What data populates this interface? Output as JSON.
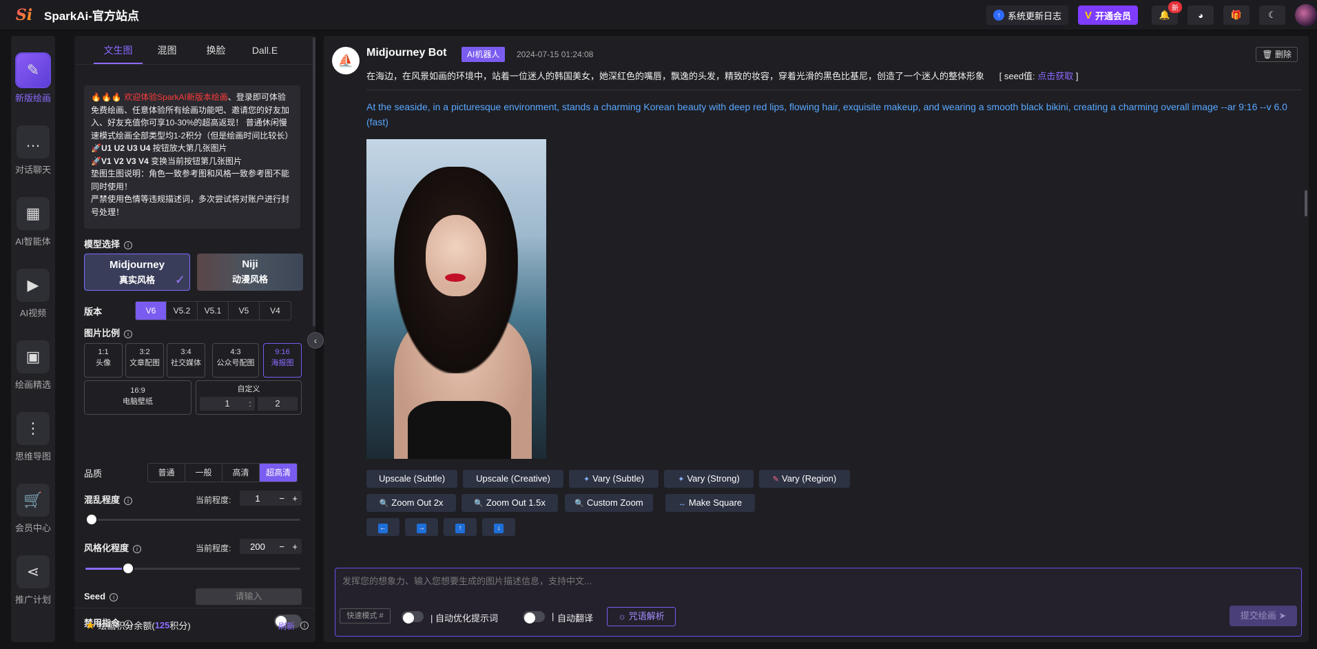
{
  "header": {
    "logo_mark": "Si",
    "title": "SparkAi-官方站点",
    "update_log": "系统更新日志",
    "vip_button": "开通会员",
    "new_badge": "新"
  },
  "nav": [
    {
      "label": "新版绘画",
      "icon": "paint-brush-icon",
      "glyph": "✎"
    },
    {
      "label": "对话聊天",
      "icon": "chat-bubble-icon",
      "glyph": "…"
    },
    {
      "label": "AI智能体",
      "icon": "grid-apps-icon",
      "glyph": "▦"
    },
    {
      "label": "AI视频",
      "icon": "video-icon",
      "glyph": "▶"
    },
    {
      "label": "绘画精选",
      "icon": "gallery-icon",
      "glyph": "▣"
    },
    {
      "label": "思维导图",
      "icon": "mindmap-icon",
      "glyph": "⋮"
    },
    {
      "label": "会员中心",
      "icon": "cart-icon",
      "glyph": "🛒"
    },
    {
      "label": "推广计划",
      "icon": "share-icon",
      "glyph": "⋖"
    }
  ],
  "panel": {
    "tabs": [
      "文生图",
      "混图",
      "换脸",
      "Dall.E"
    ],
    "notice": {
      "line1_red": "🔥🔥🔥 欢迎体验SparkAI新版本绘画",
      "line1_rest": "、登录即可体验免费绘画、任意体验所有绘画功能吧、邀请您的好友加入、好友充值你可享10-30%的超高返现！ 普通休闲慢速模式绘画全部类型均1-2积分（但是绘画时间比较长）",
      "u_line_bold": "🚀U1 U2 U3 U4",
      "u_line_rest": " 按钮放大第几张图片",
      "v_line_bold": "🚀V1 V2 V3 V4",
      "v_line_rest": " 变换当前按钮第几张图片",
      "line4": "垫图生图说明：角色一致参考图和风格一致参考图不能同时使用！",
      "line5": "严禁使用色情等违规描述词，多次尝试将对账户进行封号处理！"
    },
    "model_label": "模型选择",
    "models": [
      {
        "name": "Midjourney",
        "style": "真实风格"
      },
      {
        "name": "Niji",
        "style": "动漫风格"
      }
    ],
    "version_label": "版本",
    "versions": [
      "V6",
      "V5.2",
      "V5.1",
      "V5",
      "V4"
    ],
    "ratio_label": "图片比例",
    "ratios": [
      {
        "ratio": "1:1",
        "desc": "头像"
      },
      {
        "ratio": "3:2",
        "desc": "文章配图"
      },
      {
        "ratio": "3:4",
        "desc": "社交媒体"
      },
      {
        "ratio": "4:3",
        "desc": "公众号配图"
      },
      {
        "ratio": "9:16",
        "desc": "海报图"
      },
      {
        "ratio": "16:9",
        "desc": "电脑壁纸"
      }
    ],
    "custom_label": "自定义",
    "custom_w": "1",
    "custom_sep": ":",
    "custom_h": "2",
    "quality_label": "品质",
    "qualities": [
      "普通",
      "一般",
      "高清",
      "超高清"
    ],
    "chaos_label": "混乱程度",
    "current_label": "当前程度:",
    "chaos_value": "1",
    "chaos_level": 0.0,
    "stylize_label": "风格化程度",
    "stylize_value": "200",
    "stylize_level": 0.2,
    "seed_label": "Seed",
    "seed_placeholder": "请输入",
    "disable_label": "禁用指令",
    "credits_prefix": "绘画积分余额(",
    "credits_value": "125",
    "credits_suffix": "积分)",
    "refresh": "刷新"
  },
  "message": {
    "bot_name": "Midjourney Bot",
    "bot_tag": "AI机器人",
    "time": "2024-07-15 01:24:08",
    "delete": "删除",
    "prompt_cn": "在海边，在风景如画的环境中，站着一位迷人的韩国美女，她深红色的嘴唇，飘逸的头发，精致的妆容，穿着光滑的黑色比基尼，创造了一个迷人的整体形象",
    "seed_prefix": "[ seed值: ",
    "seed_link": "点击获取",
    "seed_suffix": " ]",
    "prompt_en": "At the seaside, in a picturesque environment, stands a charming Korean beauty with deep red lips, flowing hair, exquisite makeup, and wearing a smooth black bikini, creating a charming overall image --ar 9:16 --v 6.0  (fast)",
    "actions_row1": [
      "Upscale (Subtle)",
      "Upscale (Creative)",
      "Vary (Subtle)",
      "Vary (Strong)",
      "Vary (Region)"
    ],
    "actions_row2": [
      "Zoom Out 2x",
      "Zoom Out 1.5x",
      "Custom Zoom",
      "Make Square"
    ],
    "pan_buttons": [
      "pan-left",
      "pan-right",
      "pan-up",
      "pan-down"
    ]
  },
  "composer": {
    "placeholder": "发挥您的想象力、输入您想要生成的图片描述信息，支持中文...",
    "mode_tag": "快速模式 #",
    "auto_optimize": "自动优化提示词",
    "auto_translate": "自动翻译",
    "parse_button": "咒语解析",
    "submit": "提交绘画"
  }
}
